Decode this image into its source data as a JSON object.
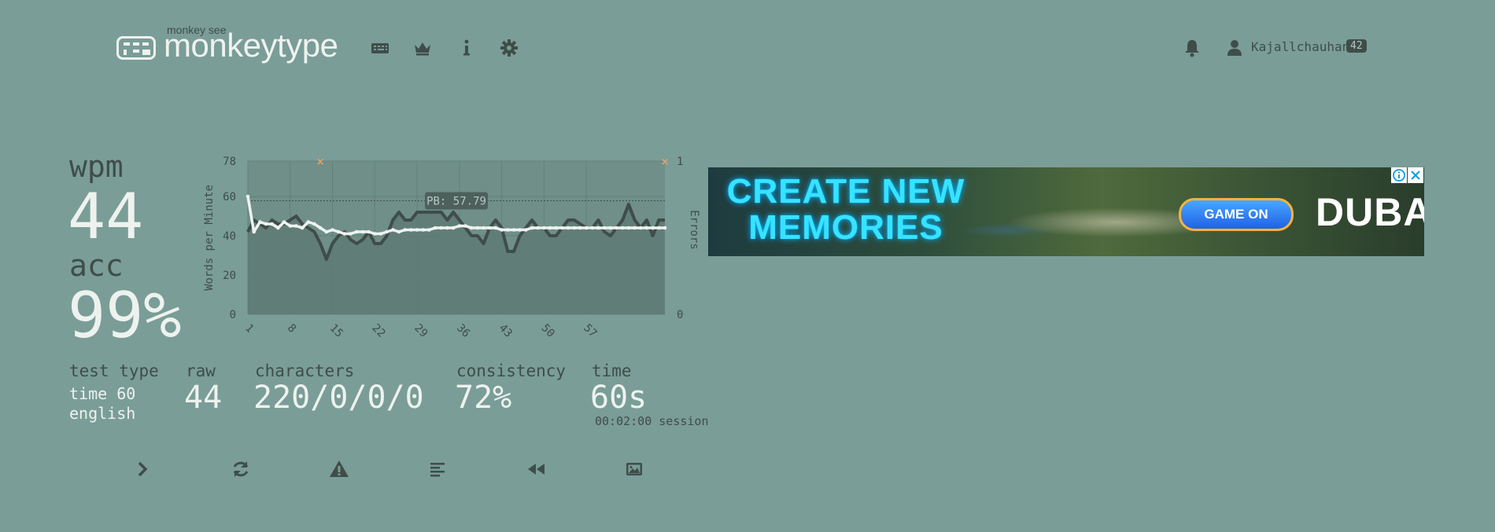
{
  "header": {
    "logo_sub": "monkey see",
    "logo_text": "monkeytype",
    "nav_icons": [
      "keyboard-icon",
      "crown-icon",
      "info-icon",
      "gear-icon"
    ],
    "user": {
      "name": "Kajallchauhan",
      "level": "42"
    },
    "bell_icon": "bell-icon",
    "user_icon": "user-icon"
  },
  "result": {
    "wpm_label": "wpm",
    "wpm": "44",
    "acc_label": "acc",
    "acc": "99%",
    "test_type_label": "test type",
    "test_type_1": "time 60",
    "test_type_2": "english",
    "raw_label": "raw",
    "raw": "44",
    "characters_label": "characters",
    "characters": "220/0/0/0",
    "consistency_label": "consistency",
    "consistency": "72%",
    "time_label": "time",
    "time": "60s",
    "session": "00:02:00 session"
  },
  "chart_data": {
    "type": "line",
    "ylabel": "Words per Minute",
    "y2label": "Errors",
    "ylim": [
      0,
      78
    ],
    "y2lim": [
      0,
      1
    ],
    "yticks": [
      "0",
      "20",
      "40",
      "60",
      "78"
    ],
    "y2ticks": [
      "0",
      "1"
    ],
    "xticks": [
      "1",
      "8",
      "15",
      "22",
      "29",
      "36",
      "43",
      "50",
      "57"
    ],
    "pb_label": "PB: 57.79",
    "pb_value": 57.79,
    "series": [
      {
        "values": [
          42,
          48,
          46,
          44,
          48,
          46,
          46,
          48,
          50,
          46,
          44,
          42,
          36,
          28,
          36,
          40,
          42,
          38,
          36,
          38,
          42,
          36,
          36,
          40,
          48,
          52,
          48,
          48,
          52,
          52,
          52,
          52,
          52,
          48,
          52,
          48,
          44,
          40,
          40,
          36,
          44,
          48,
          44,
          32,
          32,
          40,
          44,
          48,
          44,
          44,
          40,
          40,
          44,
          48,
          48,
          46,
          44,
          44,
          48,
          42,
          40,
          44,
          48,
          56,
          48,
          44,
          48,
          40,
          48,
          48
        ]
      },
      {
        "values": [
          60,
          42,
          47,
          46,
          46,
          44,
          47,
          45,
          45,
          44,
          47,
          46,
          44,
          42,
          43,
          42,
          41,
          41,
          42,
          42,
          42,
          41,
          41,
          42,
          43,
          42,
          43,
          43,
          43,
          43,
          43,
          44,
          44,
          44,
          44,
          45,
          45,
          44,
          44,
          44,
          44,
          44,
          43,
          43,
          43,
          43,
          43,
          44,
          44,
          44,
          44,
          44,
          44,
          44,
          44,
          44,
          44,
          44,
          44,
          44,
          44,
          44,
          44,
          44,
          44,
          44,
          44,
          44,
          44,
          44
        ]
      }
    ],
    "errors": [
      {
        "x": 13,
        "y": 1
      },
      {
        "x": 70,
        "y": 1
      }
    ],
    "colors": {
      "raw": "#3f4d4a",
      "wpm": "#eef2ef",
      "fill": "#5f7a74",
      "error": "#e8a06b"
    }
  },
  "ad": {
    "headline_1": "CREATE NEW",
    "headline_2": "MEMORIES",
    "cta": "GAME ON",
    "brand": "DUBAI",
    "info_icon": "ad-info-icon",
    "close_icon": "ad-close-icon"
  },
  "actions": [
    "next-test-icon",
    "restart-icon",
    "report-icon",
    "words-history-icon",
    "replay-icon",
    "screenshot-icon"
  ]
}
